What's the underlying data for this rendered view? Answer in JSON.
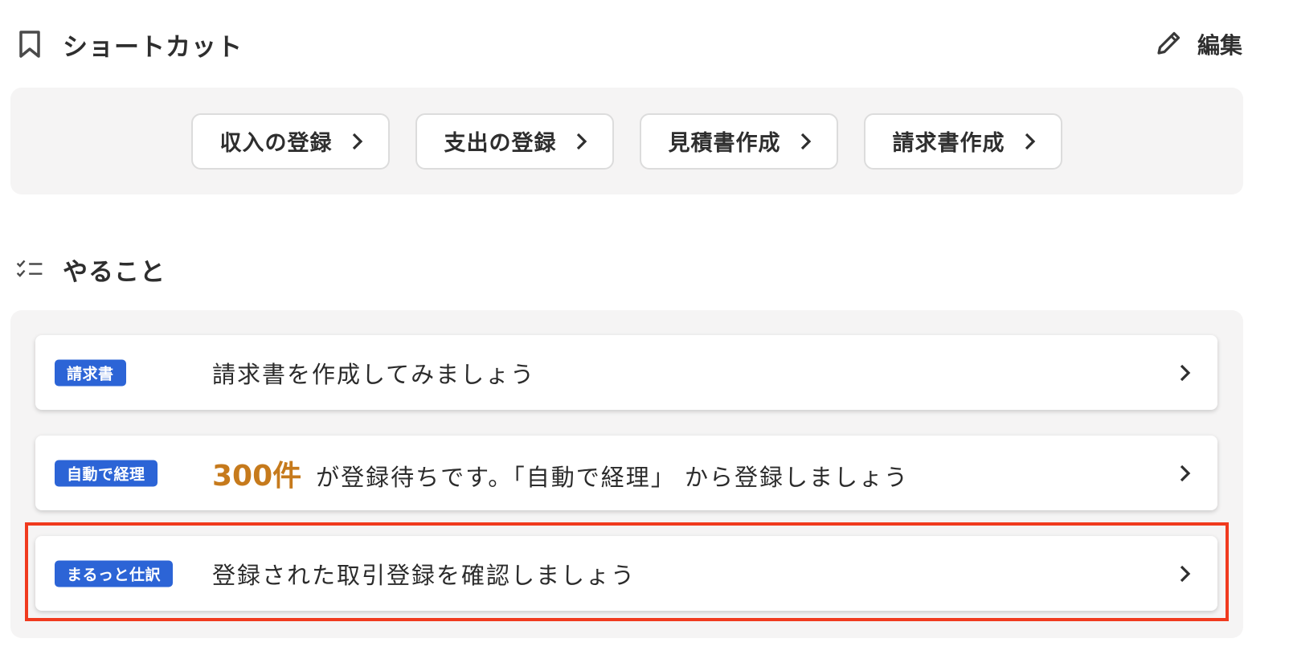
{
  "shortcuts": {
    "title": "ショートカット",
    "icon": "bookmark-icon",
    "edit_label": "編集",
    "edit_icon": "pencil-icon",
    "buttons": [
      {
        "label": "収入の登録"
      },
      {
        "label": "支出の登録"
      },
      {
        "label": "見積書作成"
      },
      {
        "label": "請求書作成"
      }
    ]
  },
  "todos": {
    "title": "やること",
    "icon": "checklist-icon",
    "items": [
      {
        "badge": "請求書",
        "text": "請求書を作成してみましょう"
      },
      {
        "badge": "自動で経理",
        "count": "300件",
        "text": "が登録待ちです。「自動で経理」 から登録しましょう"
      },
      {
        "badge": "まるっと仕訳",
        "text": "登録された取引登録を確認しましょう",
        "highlighted": true
      }
    ]
  },
  "colors": {
    "badge": "#2c64d6",
    "count": "#c67a1c",
    "highlight": "#f03a1e",
    "panel_bg": "#f5f4f4"
  }
}
